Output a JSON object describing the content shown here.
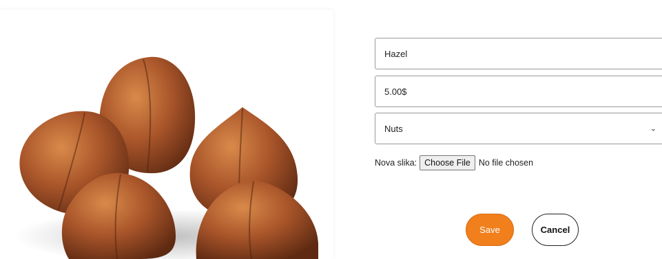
{
  "product": {
    "image_alt": "hazelnuts",
    "name_value": "Hazel",
    "price_value": "5.00$",
    "category_value": "Nuts",
    "category_options": [
      "Nuts"
    ],
    "file_label": "Nova slika:",
    "file_button_label": "Choose File",
    "file_status": "No file chosen"
  },
  "actions": {
    "save_label": "Save",
    "cancel_label": "Cancel"
  },
  "colors": {
    "accent": "#f07f1c",
    "border": "#9a9a9a"
  },
  "icons": {
    "select_chevron": "chevron-down-icon"
  }
}
